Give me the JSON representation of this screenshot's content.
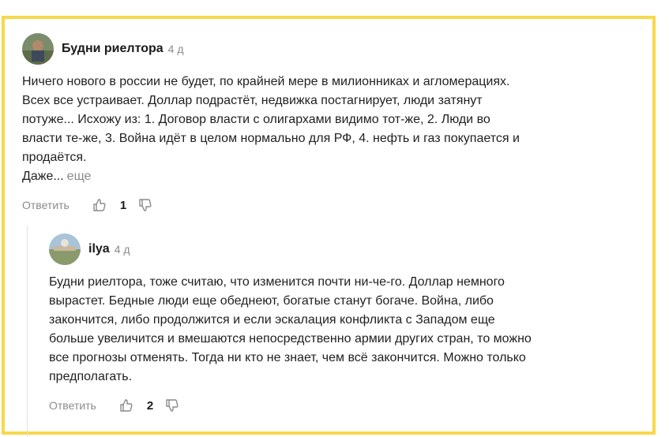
{
  "comments": [
    {
      "author": "Будни риелтора",
      "time": "4 д",
      "text_lines": [
        "Ничего нового в россии не будет, по крайней мере в милионниках и агломерациях.",
        "Всех все устраивает. Доллар подрастёт, недвижка постагнирует, люди затянут",
        "потуже... Исхожу из: 1. Договор власти с олигархами видимо тот-же, 2. Люди во",
        "власти те-же, 3. Война идёт в целом нормально для РФ, 4. нефть и газ покупается и",
        "продаётся.",
        "Даже..."
      ],
      "more_label": "еще",
      "reply_label": "Ответить",
      "like_count": "1"
    },
    {
      "author": "ilya",
      "time": "4 д",
      "text_lines": [
        "Будни риелтора, тоже считаю, что изменится почти ни-че-го. Доллар немного",
        "вырастет. Бедные люди еще обеднеют, богатые станут богаче. Война, либо",
        "закончится, либо продолжится и если эскалация конфликта с Западом еще",
        "больше увеличится и вмешаются непосредственно армии других стран, то можно",
        "все прогнозы отменять. Тогда ни кто не знает, чем всё закончится. Можно только",
        "предполагать."
      ],
      "reply_label": "Ответить",
      "like_count": "2"
    }
  ],
  "colors": {
    "frame_border": "#f7d84b",
    "muted": "#8a8a8a",
    "text": "#1f1f1f"
  },
  "icons": [
    "avatar",
    "thumbs-up-icon",
    "thumbs-down-icon"
  ]
}
